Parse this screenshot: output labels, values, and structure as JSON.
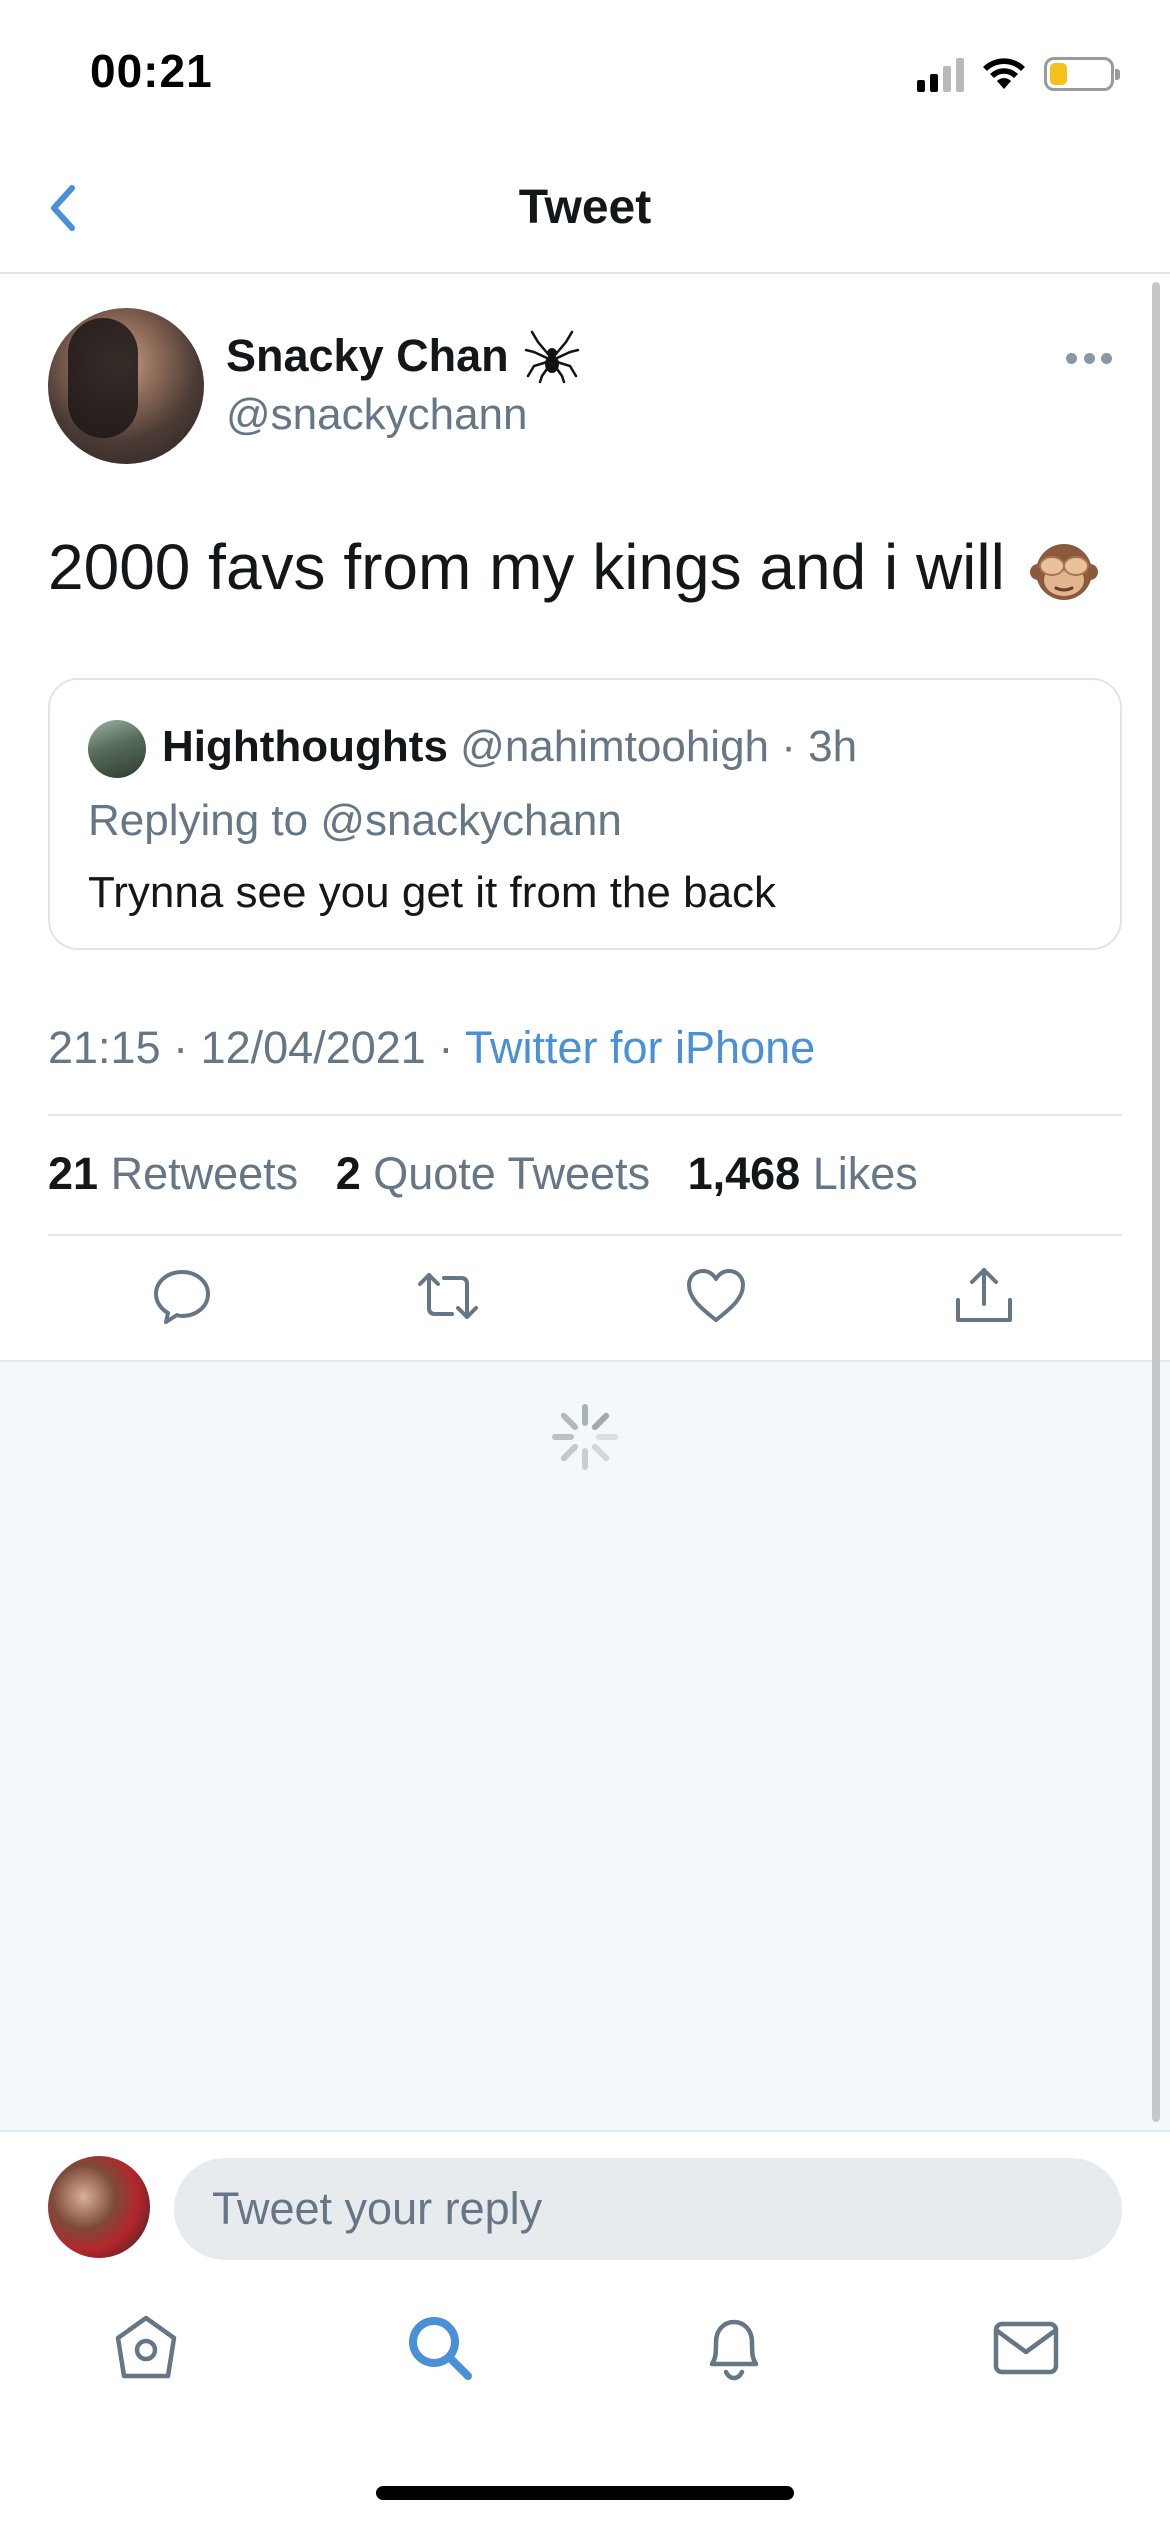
{
  "status_bar": {
    "time": "00:21",
    "signal_bars": 2,
    "signal_bars_total": 4,
    "wifi_icon": "wifi-icon",
    "battery_level": 0.3,
    "battery_color": "#f4c21c"
  },
  "header": {
    "title": "Tweet",
    "back_icon": "chevron-left-icon"
  },
  "tweet": {
    "author_name": "Snacky Chan",
    "author_name_emoji": "spider-emoji",
    "author_handle": "@snackychann",
    "text": "2000 favs from my kings and i will",
    "text_emoji": "see-no-evil-monkey-emoji",
    "more_icon": "more-horizontal-icon",
    "timestamp": "21:15 · 12/04/2021 · ",
    "source": "Twitter for iPhone",
    "retweets": "21",
    "retweets_label": "Retweets",
    "quote_tweets": "2",
    "quote_tweets_label": "Quote Tweets",
    "likes": "1,468",
    "likes_label": "Likes"
  },
  "quoted_tweet": {
    "author_name": "Highthoughts",
    "author_handle": "@nahimtoohigh",
    "age": "· 3h",
    "replying_to": "Replying to @snackychann",
    "text": "Trynna see you get it from the back"
  },
  "actions": [
    {
      "name": "reply-icon"
    },
    {
      "name": "retweet-icon"
    },
    {
      "name": "like-icon"
    },
    {
      "name": "share-icon"
    }
  ],
  "reply": {
    "placeholder": "Tweet your reply"
  },
  "tab_bar": [
    {
      "name": "home-icon",
      "active": false
    },
    {
      "name": "search-icon",
      "active": true
    },
    {
      "name": "notifications-icon",
      "active": false
    },
    {
      "name": "messages-icon",
      "active": false
    }
  ],
  "colors": {
    "accent": "#4a90d6",
    "text": "#14171a",
    "secondary_text": "#657786",
    "divider": "#e1e8ed",
    "loading_background": "#f5f8fa"
  }
}
